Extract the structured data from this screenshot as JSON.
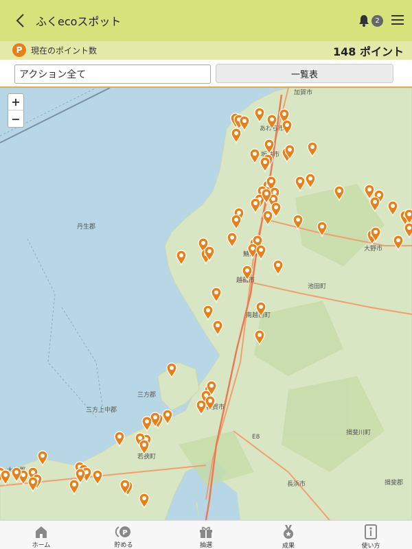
{
  "header": {
    "title": "ふくecoスポット",
    "notification_count": "2"
  },
  "points": {
    "label": "現在のポイント数",
    "badge": "P",
    "value": "148 ポイント"
  },
  "filter": {
    "action_value": "アクション全て",
    "list_button": "一覧表"
  },
  "map": {
    "zoom_in": "+",
    "zoom_out": "−",
    "place_labels": [
      "加賀市",
      "あわら市",
      "坂井市",
      "丹生郡",
      "大野市",
      "鯖江市",
      "越前市",
      "池田町",
      "南越前町",
      "三方郡",
      "三方上中郡",
      "若狭町",
      "大飯郡",
      "長浜市",
      "E8",
      "揖斐川町",
      "揖斐郡",
      "敦賀市"
    ],
    "pin_count": 112
  },
  "tabs": [
    {
      "id": "home",
      "label": "ホーム",
      "icon": "home-icon"
    },
    {
      "id": "save",
      "label": "貯める",
      "icon": "point-coin-icon"
    },
    {
      "id": "lottery",
      "label": "抽選",
      "icon": "gift-icon"
    },
    {
      "id": "results",
      "label": "成果",
      "icon": "medal-icon"
    },
    {
      "id": "howto",
      "label": "使い方",
      "icon": "info-icon"
    }
  ],
  "colors": {
    "header": "#d8e27a",
    "points_bar": "#e3e9a8",
    "accent": "#e8801a",
    "sea": "#b8d7e6",
    "land": "#d9e6c3"
  }
}
